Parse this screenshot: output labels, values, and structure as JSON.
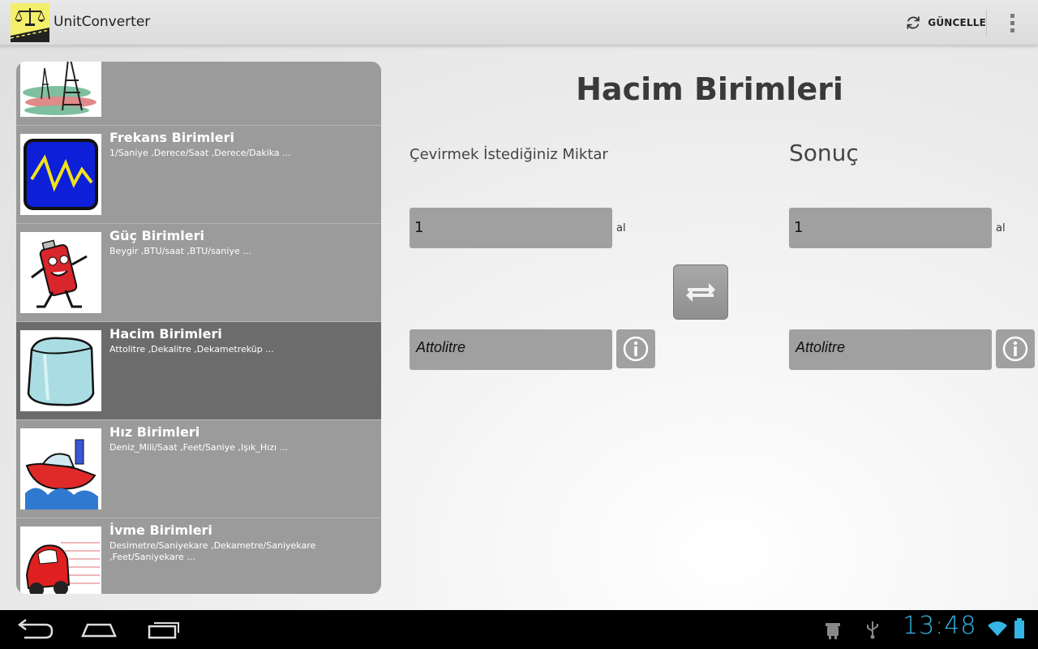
{
  "app": {
    "title": "UnitConverter",
    "update_label": "GÜNCELLE"
  },
  "list": {
    "items": [
      {
        "title": "",
        "desc": "",
        "icon": "power-tower-icon"
      },
      {
        "title": "Frekans Birimleri",
        "desc": "1/Saniye ,Derece/Saat ,Derece/Dakika ...",
        "icon": "frequency-wave-icon"
      },
      {
        "title": "Güç Birimleri",
        "desc": "Beygir ,BTU/saat ,BTU/saniye ...",
        "icon": "battery-character-icon"
      },
      {
        "title": "Hacim Birimleri",
        "desc": "Attolitre ,Dekalitre ,Dekametreküp ...",
        "icon": "ice-cube-icon",
        "selected": true
      },
      {
        "title": "Hız Birimleri",
        "desc": "Deniz_Mili/Saat ,Feet/Saniye ,Işık_Hızı ...",
        "icon": "speedboat-icon"
      },
      {
        "title": "İvme Birimleri",
        "desc": "Desimetre/Saniyekare ,Dekametre/Saniyekare ,Feet/Saniyekare ...",
        "icon": "racing-car-icon"
      }
    ]
  },
  "main": {
    "title": "Hacim Birimleri",
    "amount_label": "Çevirmek İstediğiniz Miktar",
    "result_label": "Sonuç",
    "input_value": "1",
    "input_suffix": "al",
    "result_value": "1",
    "result_suffix": "al",
    "from_unit": "Attolitre",
    "to_unit": "Attolitre"
  },
  "status": {
    "time": "13:48"
  },
  "colors": {
    "accent": "#33b5e5",
    "list_bg": "#9b9b9b",
    "list_selected": "#6c6c6c"
  }
}
